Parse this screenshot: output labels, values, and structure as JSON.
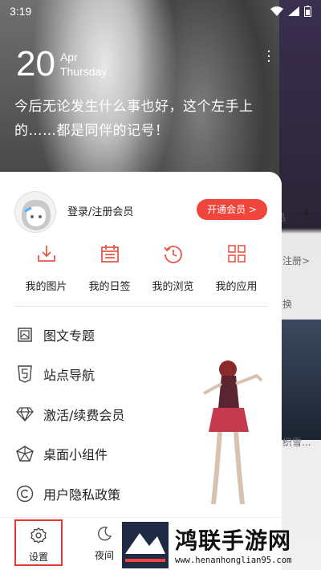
{
  "status": {
    "time": "3:19"
  },
  "date": {
    "day": "20",
    "month": "Apr",
    "weekday": "Thursday"
  },
  "quote": "今后无论发生什么事也好，这个左手上的……都是同伴的记号！",
  "right_strip": {
    "tab_hint": "热",
    "login_hint": "注册>",
    "swap_hint": "换",
    "caption_hint": "织雪..."
  },
  "user": {
    "login_label": "登录/注册会员",
    "vip_button": "开通会员 >"
  },
  "quick": [
    {
      "label": "我的图片",
      "icon": "download-icon"
    },
    {
      "label": "我的日签",
      "icon": "calendar-icon"
    },
    {
      "label": "我的浏览",
      "icon": "history-icon"
    },
    {
      "label": "我的应用",
      "icon": "apps-grid-icon"
    }
  ],
  "menu": [
    {
      "label": "图文专题",
      "icon": "image-topic-icon"
    },
    {
      "label": "站点导航",
      "icon": "html5-icon"
    },
    {
      "label": "激活/续费会员",
      "icon": "diamond-icon"
    },
    {
      "label": "桌面小组件",
      "icon": "widget-icon"
    },
    {
      "label": "用户隐私政策",
      "icon": "copyright-icon"
    }
  ],
  "bottom": {
    "settings": "设置",
    "night": "夜间"
  },
  "watermark": {
    "title": "鸿联手游网",
    "url": "www.henanhonglian95.com"
  },
  "colors": {
    "accent": "#f0453a",
    "icon_red": "#e8584a"
  }
}
